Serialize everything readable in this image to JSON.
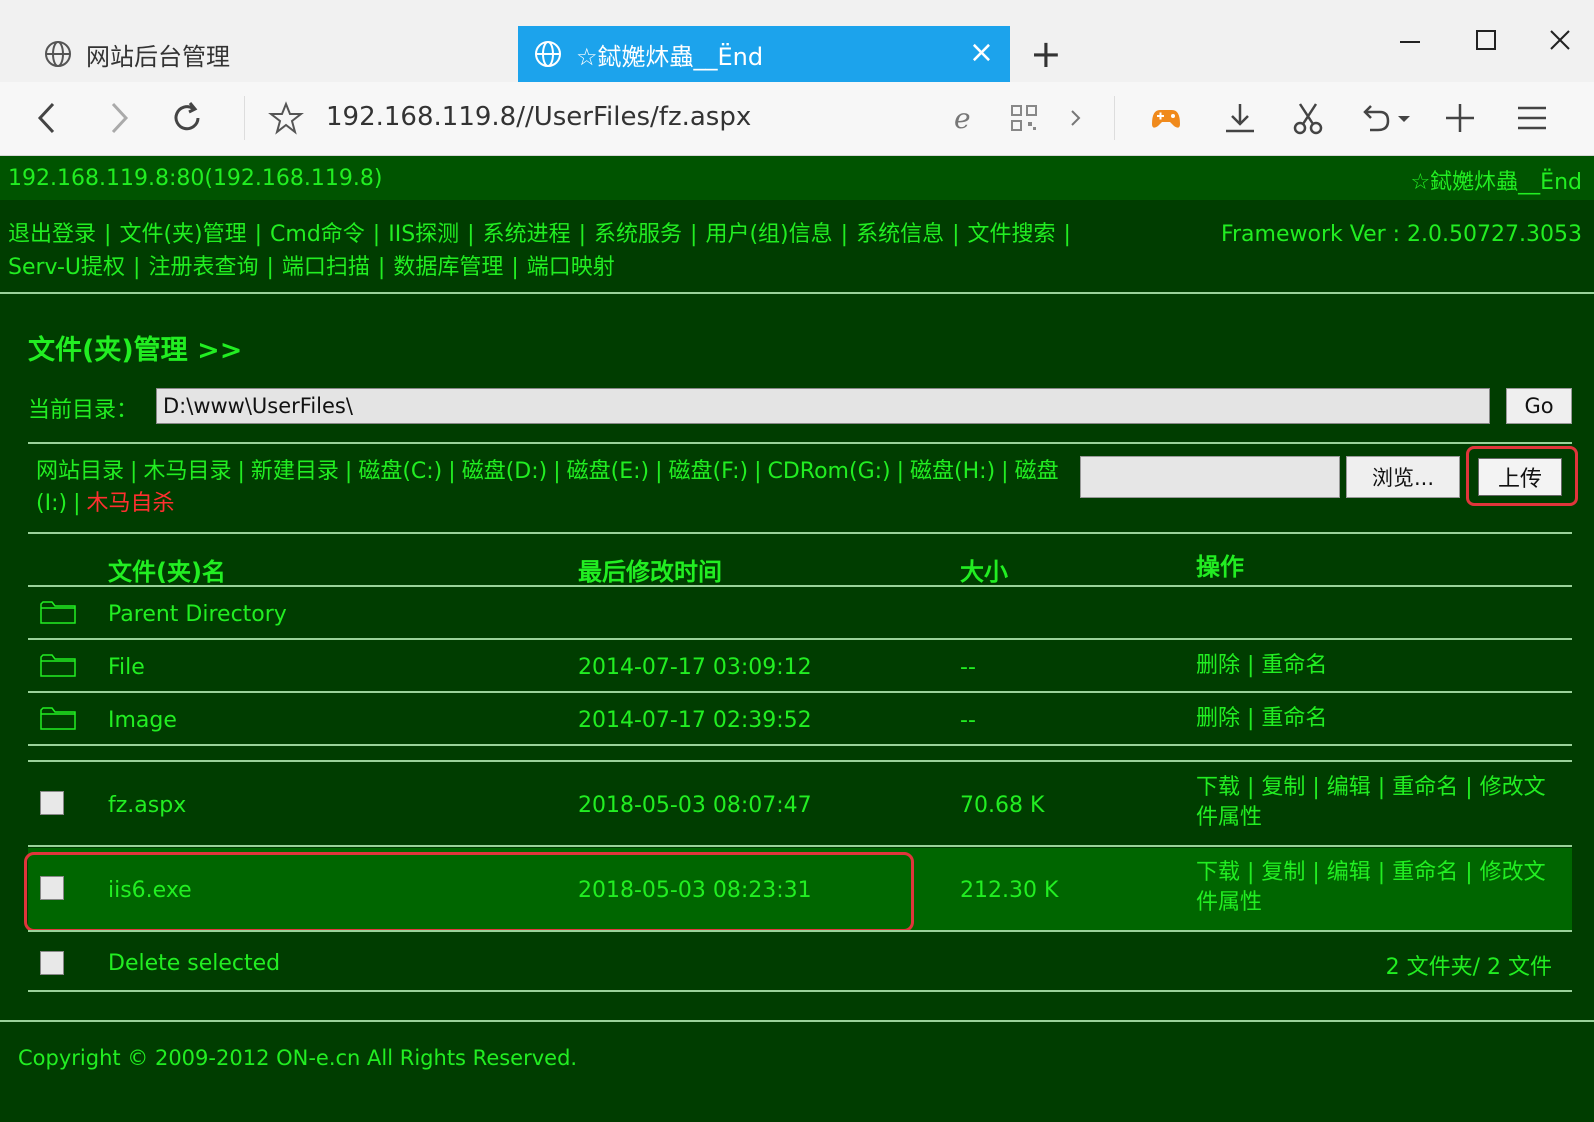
{
  "browser": {
    "tabs": [
      {
        "title": "网站后台管理",
        "active": false
      },
      {
        "title": "☆鋱嬔炑蟲__Ënd",
        "active": true
      }
    ],
    "url": "192.168.119.8//UserFiles/fz.aspx",
    "accent_color": "#1ca3ec",
    "icons": [
      "back-icon",
      "forward-icon",
      "refresh-icon",
      "star-icon",
      "ie-icon",
      "qr-icon",
      "chevron-right-icon",
      "gamepad-icon",
      "download-icon",
      "scissors-icon",
      "undo-icon",
      "plus-icon",
      "menu-icon"
    ]
  },
  "header": {
    "host": "192.168.119.8:80(192.168.119.8)",
    "brand": "☆鋱嬔炑蟲__Ënd",
    "framework": "Framework Ver : 2.0.50727.3053",
    "menu": [
      "退出登录",
      "文件(夹)管理",
      "Cmd命令",
      "IIS探测",
      "系统进程",
      "系统服务",
      "用户(组)信息",
      "系统信息",
      "文件搜索",
      "Serv-U提权",
      "注册表查询",
      "端口扫描",
      "数据库管理",
      "端口映射"
    ]
  },
  "filemanager": {
    "title": "文件(夹)管理 >>",
    "dir_label": "当前目录：",
    "dir_value": "D:\\www\\UserFiles\\",
    "go": "Go",
    "links": [
      "网站目录",
      "木马目录",
      "新建目录",
      "磁盘(C:)",
      "磁盘(D:)",
      "磁盘(E:)",
      "磁盘(F:)",
      "CDRom(G:)",
      "磁盘(H:)",
      "磁盘(I:)"
    ],
    "self_destruct": "木马自杀",
    "browse": "浏览...",
    "upload": "上传",
    "columns": [
      "文件(夹)名",
      "最后修改时间",
      "大小",
      "操作"
    ],
    "parent": "Parent Directory",
    "folders": [
      {
        "name": "File",
        "time": "2014-07-17 03:09:12",
        "size": "--",
        "ops": "删除 | 重命名"
      },
      {
        "name": "Image",
        "time": "2014-07-17 02:39:52",
        "size": "--",
        "ops": "删除 | 重命名"
      }
    ],
    "files": [
      {
        "name": "fz.aspx",
        "time": "2018-05-03 08:07:47",
        "size": "70.68 K",
        "ops": "下载 | 复制 | 编辑 | 重命名 | 修改文件属性"
      },
      {
        "name": "iis6.exe",
        "time": "2018-05-03 08:23:31",
        "size": "212.30 K",
        "ops": "下载 | 复制 | 编辑 | 重命名 | 修改文件属性"
      }
    ],
    "delete_selected": "Delete selected",
    "summary": "2 文件夹/ 2 文件",
    "colors": {
      "background": "#003d00",
      "text": "#22ee22",
      "highlight": "#e0353b",
      "self_destruct": "#ff3030"
    }
  },
  "footer": {
    "copyright": "Copyright © 2009-2012 ON-e.cn All Rights Reserved."
  }
}
